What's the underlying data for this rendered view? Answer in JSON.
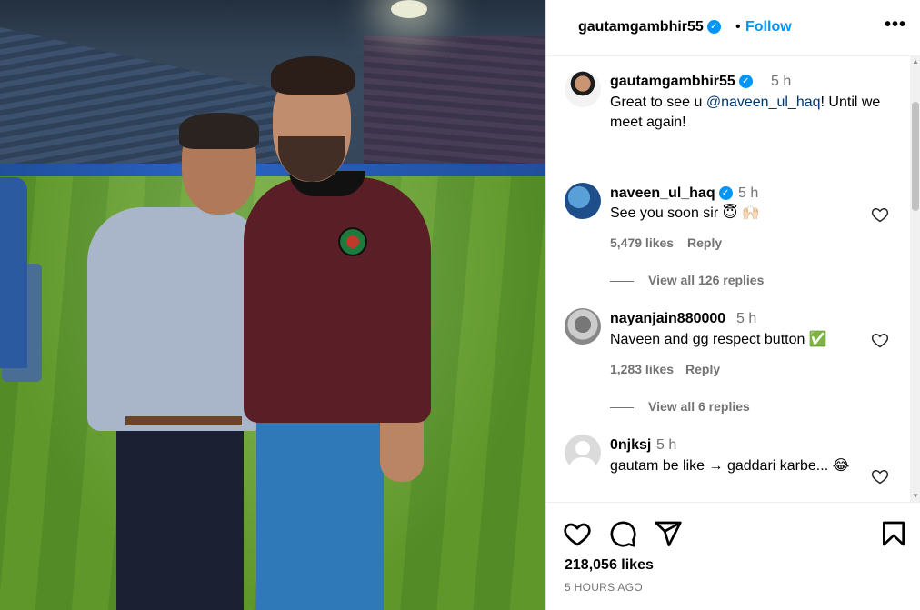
{
  "post": {
    "author": "gautamgambhir55",
    "follow_label": "Follow",
    "dot": "•",
    "more": "•••"
  },
  "comments": [
    {
      "user": "gautamgambhir55",
      "time": "5 h",
      "text_before": "Great to see u ",
      "mention": "@naveen_ul_haq",
      "text_after": "! Until we meet again!",
      "avatar": "gautam-avatar",
      "verified": true
    },
    {
      "user": "naveen_ul_haq",
      "time": "5 h",
      "text": "See you soon sir 😇 🙌🏻",
      "likes": "5,479 likes",
      "reply": "Reply",
      "view_replies": "View all 126 replies",
      "avatar": "naveen-avatar",
      "verified": true
    },
    {
      "user": "nayanjain880000",
      "time": "5 h",
      "text": "Naveen and gg respect button ✅",
      "likes": "1,283 likes",
      "reply": "Reply",
      "view_replies": "View all 6 replies",
      "avatar": "nayan-avatar",
      "verified": false
    },
    {
      "user": "0njksj",
      "time": "5 h",
      "text": "gautam be like → gaddari karbe... 😂",
      "avatar": "default-avatar",
      "verified": false
    }
  ],
  "footer": {
    "likes": "218,056 likes",
    "ago": "5 HOURS AGO"
  },
  "colors": {
    "accent": "#0095f6",
    "mention": "#00376b",
    "muted": "#737373",
    "verified": "#0095f6"
  },
  "icons": [
    "heart-icon",
    "comment-icon",
    "share-icon",
    "bookmark-icon",
    "verified-badge-icon",
    "more-options-icon"
  ]
}
